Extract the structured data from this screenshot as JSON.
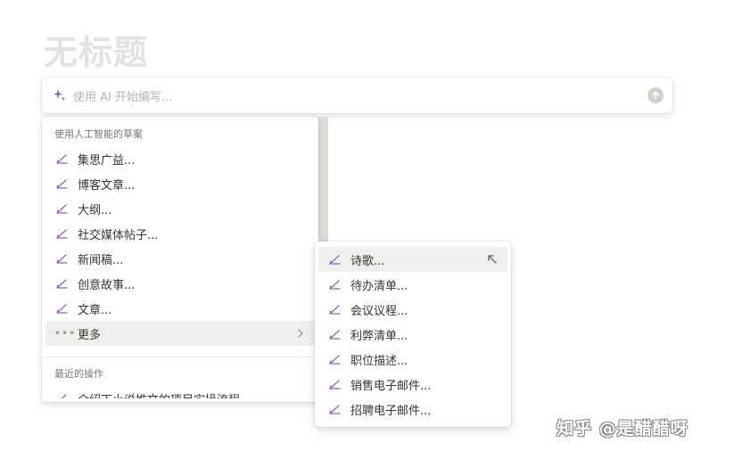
{
  "page": {
    "title": "无标题"
  },
  "ai_bar": {
    "placeholder": "使用 AI 开始编写..."
  },
  "menu": {
    "section_draft": "使用人工智能的草案",
    "items": [
      {
        "label": "集思广益..."
      },
      {
        "label": "博客文章..."
      },
      {
        "label": "大纲..."
      },
      {
        "label": "社交媒体帖子..."
      },
      {
        "label": "新闻稿..."
      },
      {
        "label": "创意故事..."
      },
      {
        "label": "文章..."
      }
    ],
    "more_label": "更多",
    "section_recent": "最近的操作",
    "recent_items": [
      {
        "label": "介绍下小说推文的项目实操流程"
      }
    ]
  },
  "submenu": {
    "items": [
      {
        "label": "诗歌..."
      },
      {
        "label": "待办清单..."
      },
      {
        "label": "会议议程..."
      },
      {
        "label": "利弊清单..."
      },
      {
        "label": "职位描述..."
      },
      {
        "label": "销售电子邮件..."
      },
      {
        "label": "招聘电子邮件..."
      }
    ]
  },
  "watermark": {
    "text": "知乎 @是醋醋呀"
  },
  "colors": {
    "accent": "#9065b0",
    "placeholder": "#b5b3ad",
    "title": "#e3e2e0",
    "hover": "#efefed"
  },
  "icons": {
    "spark": "sparkle-icon",
    "pen": "pen-icon",
    "more": "more-dots-icon",
    "chevron": "chevron-right-icon",
    "submit": "arrow-up-circle-icon",
    "cursor": "cursor-arrow-icon"
  }
}
